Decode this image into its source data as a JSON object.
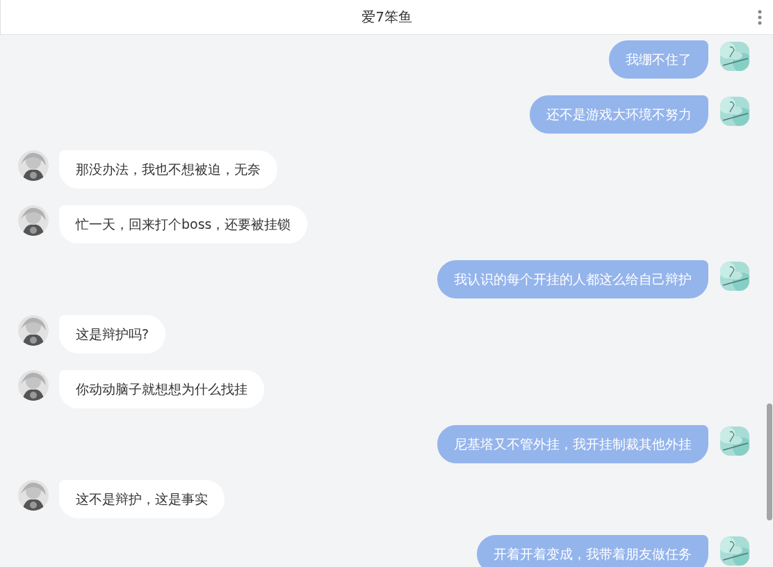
{
  "header": {
    "title": "爱7笨鱼"
  },
  "messages": [
    {
      "kind": "outgoing",
      "text": "我绷不住了"
    },
    {
      "kind": "outgoing",
      "text": "还不是游戏大环境不努力"
    },
    {
      "kind": "incoming",
      "text": "那没办法，我也不想被迫，无奈"
    },
    {
      "kind": "incoming",
      "text": "忙一天，回来打个boss，还要被挂锁"
    },
    {
      "kind": "outgoing",
      "text": "我认识的每个开挂的人都这么给自己辩护"
    },
    {
      "kind": "incoming",
      "text": "这是辩护吗?"
    },
    {
      "kind": "incoming",
      "text": "你动动脑子就想想为什么找挂"
    },
    {
      "kind": "outgoing",
      "text": "尼基塔又不管外挂，我开挂制裁其他外挂"
    },
    {
      "kind": "incoming",
      "text": "这不是辩护，这是事实"
    },
    {
      "kind": "outgoing",
      "text": "开着开着变成，我带着朋友做任务"
    }
  ]
}
